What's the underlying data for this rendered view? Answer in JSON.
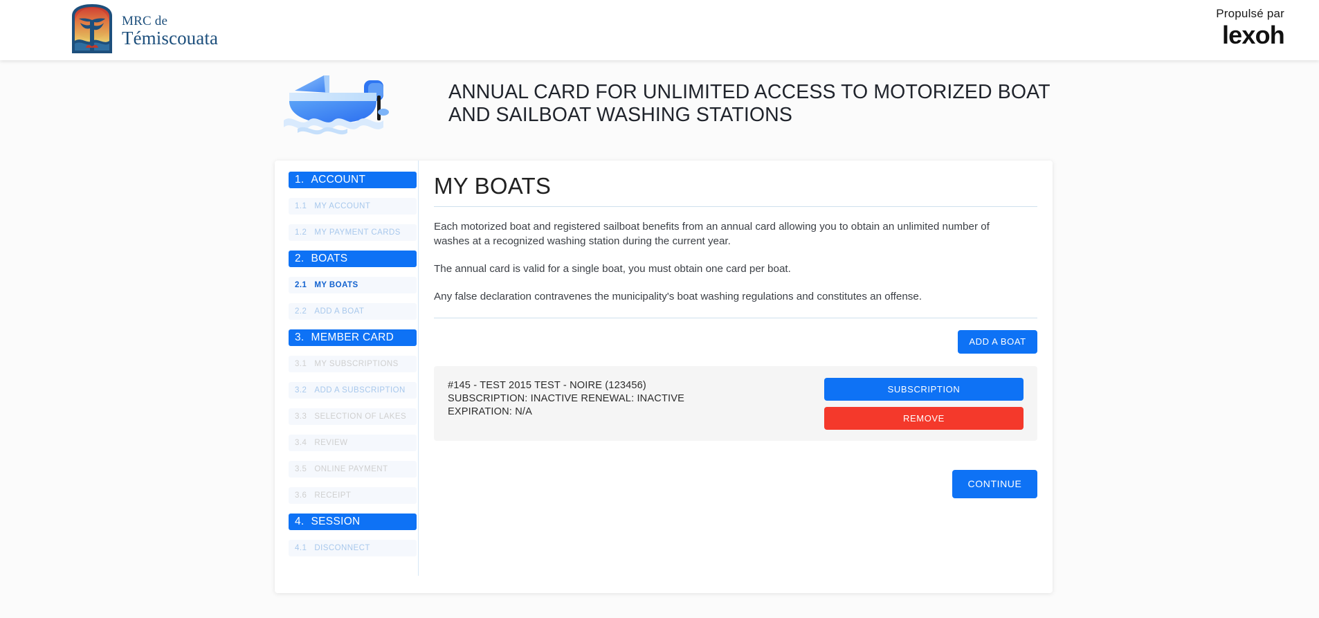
{
  "header": {
    "logo_line1": "MRC de",
    "logo_line2": "Témiscouata",
    "logo_icon": "temiscouata-crest-icon",
    "powered_by": "Propulsé par",
    "vendor": "lexoh"
  },
  "hero": {
    "boat_icon": "motorboat-illustration",
    "title": "ANNUAL CARD FOR UNLIMITED ACCESS TO MOTORIZED BOAT AND SAILBOAT WASHING STATIONS"
  },
  "sidebar": {
    "groups": [
      {
        "num": "1.",
        "label": "ACCOUNT",
        "items": [
          {
            "num": "1.1",
            "label": "MY ACCOUNT",
            "state": "link"
          },
          {
            "num": "1.2",
            "label": "MY PAYMENT CARDS",
            "state": "link"
          }
        ]
      },
      {
        "num": "2.",
        "label": "BOATS",
        "items": [
          {
            "num": "2.1",
            "label": "MY BOATS",
            "state": "active"
          },
          {
            "num": "2.2",
            "label": "ADD A BOAT",
            "state": "link"
          }
        ]
      },
      {
        "num": "3.",
        "label": "MEMBER CARD",
        "items": [
          {
            "num": "3.1",
            "label": "MY SUBSCRIPTIONS",
            "state": "muted"
          },
          {
            "num": "3.2",
            "label": "ADD A SUBSCRIPTION",
            "state": "link"
          },
          {
            "num": "3.3",
            "label": "SELECTION OF LAKES",
            "state": "muted"
          },
          {
            "num": "3.4",
            "label": "REVIEW",
            "state": "muted"
          },
          {
            "num": "3.5",
            "label": "ONLINE PAYMENT",
            "state": "muted"
          },
          {
            "num": "3.6",
            "label": "RECEIPT",
            "state": "muted"
          }
        ]
      },
      {
        "num": "4.",
        "label": "SESSION",
        "items": [
          {
            "num": "4.1",
            "label": "DISCONNECT",
            "state": "link"
          }
        ]
      }
    ]
  },
  "main": {
    "page_title": "MY BOATS",
    "paragraphs": [
      "Each motorized boat and registered sailboat benefits from an annual card allowing you to obtain an unlimited number of washes at a recognized washing station during the current year.",
      "The annual card is valid for a single boat, you must obtain one card per boat.",
      "Any false declaration contravenes the municipality's boat washing regulations and constitutes an offense."
    ],
    "add_boat_label": "ADD A BOAT",
    "continue_label": "CONTINUE",
    "boats": [
      {
        "title": "#145 - TEST 2015 TEST - NOIRE (123456)",
        "status_line": "SUBSCRIPTION: INACTIVE    RENEWAL: INACTIVE",
        "expiration_line": "EXPIRATION: N/A",
        "subscription_label": "SUBSCRIPTION",
        "remove_label": "REMOVE"
      }
    ]
  },
  "colors": {
    "accent_blue": "#0e72f5",
    "danger_red": "#f4392b",
    "page_bg": "#fbfbfb",
    "card_bg": "#f5f5f5",
    "rule": "#cfe0ee"
  }
}
